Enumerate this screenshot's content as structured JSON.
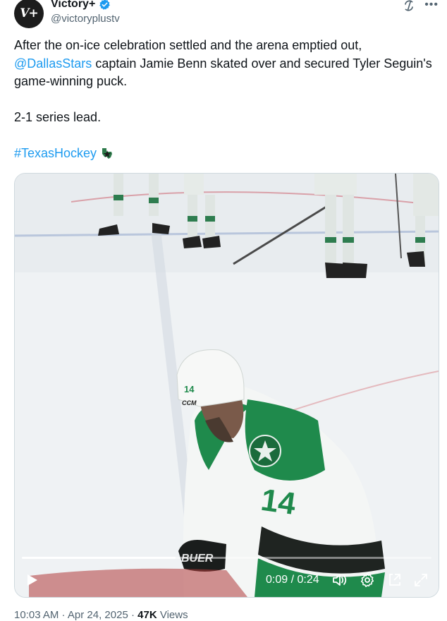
{
  "author": {
    "display_name": "Victory+",
    "handle": "@victoryplustv",
    "avatar_text": "V+"
  },
  "tweet": {
    "line1": "After the on-ice celebration settled and the arena emptied out,",
    "mention": "@DallasStars",
    "line2_rest": " captain Jamie Benn skated over and secured Tyler Seguin's",
    "line3": "game-winning puck.",
    "line4": "2-1 series lead.",
    "hashtag": "#TexasHockey"
  },
  "video": {
    "jersey_number": "14",
    "helmet_brand": "CCM",
    "glove_brand": "BUER",
    "current_time": "0:09",
    "duration": "0:24",
    "time_display": "0:09 / 0:24",
    "progress": 0.375
  },
  "meta": {
    "time": "10:03 AM",
    "separator1": " · ",
    "date": "Apr 24, 2025",
    "separator2": " · ",
    "views_count": "47K",
    "views_label": " Views"
  },
  "colors": {
    "link": "#1d9bf0",
    "verified": "#1d9bf0",
    "stars_green": "#1f8a4c"
  }
}
